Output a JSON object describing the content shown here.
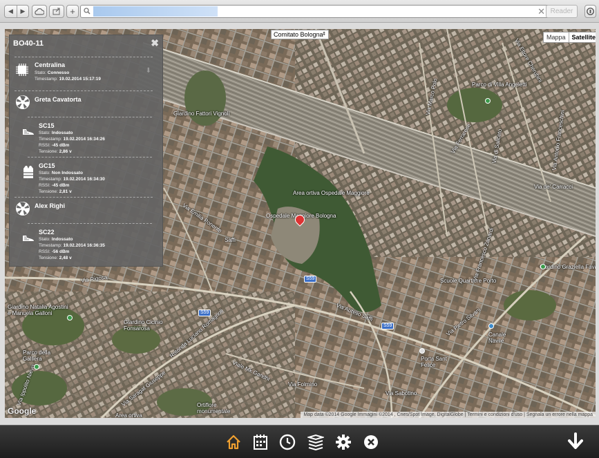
{
  "browser": {
    "reader_label": "Reader",
    "clear_glyph": "✕"
  },
  "map": {
    "region_select": "Comitato Bologna",
    "map_types": [
      "Mappa",
      "Satellite"
    ],
    "active_map_type": "Satellite",
    "credits": "Map data ©2014 Google Immagini ©2014 , Cnes/Spot Image, DigitalGlobe  |  Termini e condizioni d'uso  |  Segnala un errore nella mappa",
    "google_logo": "Google",
    "labels": {
      "scala_marco_polo": "Via Marco Polo",
      "ferrara": "Via Ferrarese",
      "parco_villa": "Parco di Villa Angeletti",
      "giardino_fantoni": "Giardino Fattori Vignoli",
      "via_gagarin": "Via di Saliceto",
      "via_franceschini": "Via Antonio Franceschini",
      "via_barracchi": "Via de' Carracci",
      "area_ortiva": "Area ortiva Ospedale Maggiore",
      "ospedale": "Ospedale Maggiore Bologna",
      "via_emilia": "Via Emilia Ponente",
      "via_saffi_top": "Saffi",
      "via_rigosa": "Via Rigosa",
      "stazione": "Scuole Quartiere Porto",
      "giardino_graziella": "Giardino Graziella Fava",
      "giardino_natalia": "Giardino Natalia Agostini e Manuela Galloni",
      "giardino_vicini": "Giardino Cicinio Fonsarosa",
      "via_aurelio_saffi": "Via Aurelio Saffi",
      "via_saragat": "Via Saragat Giuseppe",
      "rotonda": "Rotonda Luciano Romagnoli",
      "viale_gandhi": "Viale Mk Gandhi",
      "via_folmino": "Via Folmino",
      "via_sabotino": "Via Sabotino",
      "porta_santa": "Porta Sant Felice",
      "canale_navile": "Canale Navile",
      "via_pietro": "Via Pietro Silvani",
      "parco_galieni": "Parco della Galliera",
      "cimitero": "Ortiflore monumentale",
      "area_ortiva_bottom": "Area ortiva",
      "via_nuova": "Via Ippolito Nievo",
      "via_zanardi": "Via Francesco Zanardi",
      "shield_1": "S59",
      "shield_2": "S59",
      "shield_3": "S59",
      "via_cherubini": "Via Ettore Cherubini"
    }
  },
  "panel": {
    "title": "BO40-11",
    "close_glyph": "✖",
    "central": {
      "name": "Centralina",
      "stato_label": "Stato:",
      "stato_value": "Connesso",
      "timestamp_label": "Timestamp:",
      "timestamp_value": "19.02.2014 15:17:19"
    },
    "person1": {
      "name": "Greta Cavatorta"
    },
    "sc15": {
      "name": "SC15",
      "stato_label": "Stato:",
      "stato_value": "Indossato",
      "timestamp_label": "Timestamp:",
      "timestamp_value": "19.02.2014 16:34:26",
      "rssi_label": "RSSI:",
      "rssi_value": "-45 dBm",
      "tensione_label": "Tensione:",
      "tensione_value": "2,86 v"
    },
    "gc15": {
      "name": "GC15",
      "stato_label": "Stato:",
      "stato_value": "Non Indossato",
      "timestamp_label": "Timestamp:",
      "timestamp_value": "19.02.2014 16:34:30",
      "rssi_label": "RSSI:",
      "rssi_value": "-45 dBm",
      "tensione_label": "Tensione:",
      "tensione_value": "2,81 v"
    },
    "person2": {
      "name": "Alex Righi"
    },
    "sc22": {
      "name": "SC22",
      "stato_label": "Stato:",
      "stato_value": "Indossato",
      "timestamp_label": "Timestamp:",
      "timestamp_value": "19.02.2014 16:36:35",
      "rssi_label": "RSSI:",
      "rssi_value": "-56 dBm",
      "tensione_label": "Tensione:",
      "tensione_value": "2,48 v"
    }
  },
  "toolbar": {
    "icons": [
      "home-icon",
      "calendar-icon",
      "clock-icon",
      "layers-icon",
      "gear-icon",
      "close-circle-icon",
      "download-arrow-icon"
    ],
    "accent": "#f0a030"
  }
}
